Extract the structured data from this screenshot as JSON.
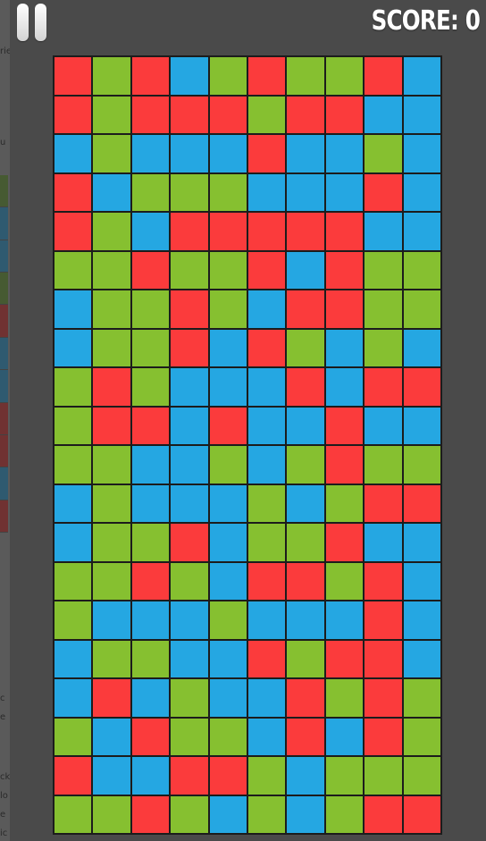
{
  "hud": {
    "score_text": "SCORE: 0",
    "pause_icon": "pause-icon"
  },
  "colors": {
    "R": "#fb3b3c",
    "G": "#86c030",
    "B": "#25a7e2"
  },
  "board": {
    "columns": 10,
    "rows": [
      "RGRBGRGGRB",
      "RGRRRGRRBB",
      "BGBBBRBBGB",
      "RBGGGBBBRB",
      "RGBRRRRRBB",
      "GGRGGRBRGG",
      "BGGRGBRRGG",
      "BGGRBRGBGB",
      "GRGBBBRBRR",
      "GRRBRBBRBB",
      "GGBBGBGRGG",
      "BGBBBGBGRR",
      "BGGRBGGRBB",
      "GGRGBRRGRB",
      "GBBBGBBBRB",
      "BGGBBRGRRB",
      "BRBGBBRGRG",
      "GBRGGBRBRG",
      "RBBRRGBGGG",
      "GGRGBGBGRR"
    ]
  }
}
